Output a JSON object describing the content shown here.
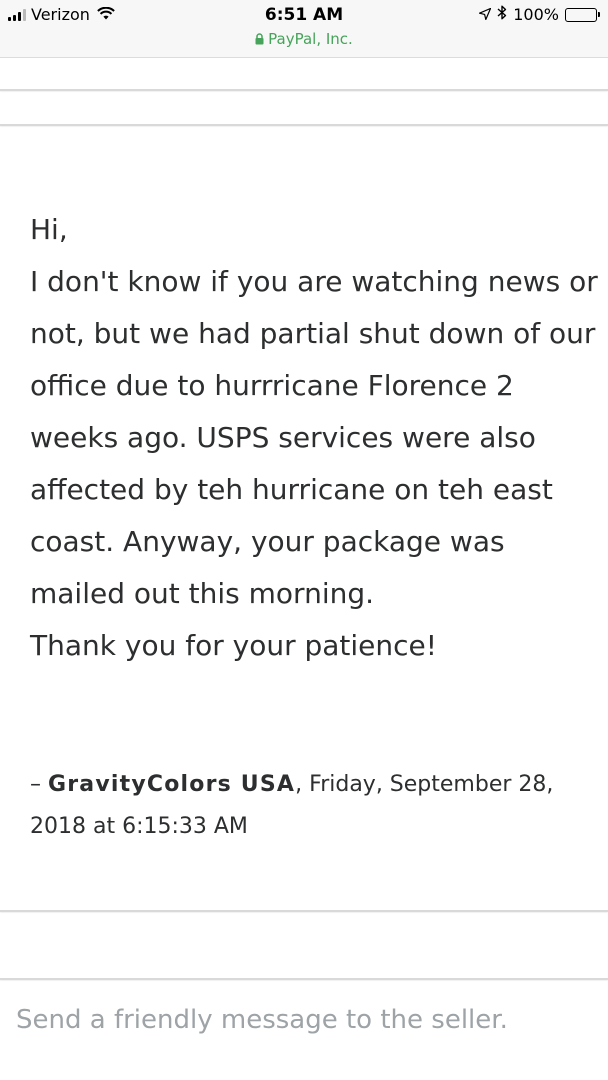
{
  "status_bar": {
    "carrier": "Verizon",
    "time": "6:51 AM",
    "battery": "100%",
    "site": "PayPal, Inc.",
    "site_color": "#46a35a",
    "icons": [
      "signal-icon",
      "wifi-icon",
      "location-icon",
      "bluetooth-icon",
      "battery-icon",
      "lock-icon"
    ]
  },
  "message": {
    "body": "Hi,\nI don't know if you are watching news or not, but we had partial shut down of our office due to hurrricane Florence 2 weeks ago. USPS services were also affected by teh hurricane on teh east coast. Anyway, your package was mailed out this morning.\nThank you for your patience!",
    "signature_prefix": "– ",
    "sender": "GravityColors USA",
    "timestamp": ", Friday, September 28, 2018 at 6:15:33 AM"
  },
  "compose": {
    "placeholder": "Send a friendly message to the seller.",
    "value": ""
  }
}
